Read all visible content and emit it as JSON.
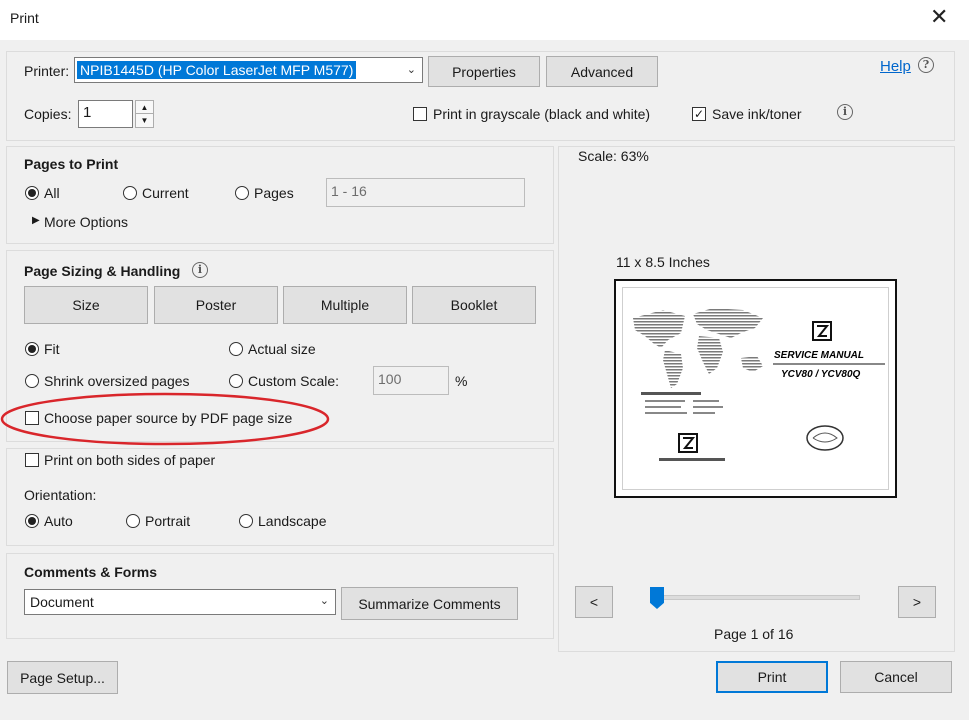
{
  "window": {
    "title": "Print",
    "close_glyph": "✕"
  },
  "header": {
    "printer_label": "Printer:",
    "printer_value": "NPIB1445D (HP Color LaserJet MFP M577)",
    "properties_label": "Properties",
    "advanced_label": "Advanced",
    "help_label": "Help",
    "copies_label": "Copies:",
    "copies_value": "1",
    "grayscale_label": "Print in grayscale (black and white)",
    "grayscale_checked": false,
    "save_ink_label": "Save ink/toner",
    "save_ink_checked": true
  },
  "pages_to_print": {
    "title": "Pages to Print",
    "all_label": "All",
    "current_label": "Current",
    "pages_label": "Pages",
    "pages_range": "1 - 16",
    "more_options_label": "More Options",
    "selected": "All"
  },
  "sizing": {
    "title": "Page Sizing & Handling",
    "tabs": [
      "Size",
      "Poster",
      "Multiple",
      "Booklet"
    ],
    "fit_label": "Fit",
    "actual_label": "Actual size",
    "shrink_label": "Shrink oversized pages",
    "custom_label": "Custom Scale:",
    "custom_value": "100",
    "percent": "%",
    "paper_source_label": "Choose paper source by PDF page size",
    "selected": "Fit"
  },
  "duplex": {
    "both_sides_label": "Print on both sides of paper",
    "orientation_label": "Orientation:",
    "auto_label": "Auto",
    "portrait_label": "Portrait",
    "landscape_label": "Landscape",
    "selected": "Auto"
  },
  "comments": {
    "title": "Comments & Forms",
    "select_value": "Document",
    "summarize_label": "Summarize Comments"
  },
  "preview": {
    "scale_text": "Scale:  63%",
    "size_text": "11 x 8.5 Inches",
    "manual_title": "SERVICE MANUAL",
    "manual_model": "YCV80 / YCV80Q",
    "prev_label": "<",
    "next_label": ">",
    "page_indicator": "Page 1 of 16",
    "slider_position": 0.0
  },
  "footer": {
    "page_setup_label": "Page Setup...",
    "print_label": "Print",
    "cancel_label": "Cancel"
  },
  "colors": {
    "accent": "#0078d7",
    "link": "#0066cc",
    "annotation_oval": "#d9262b"
  }
}
